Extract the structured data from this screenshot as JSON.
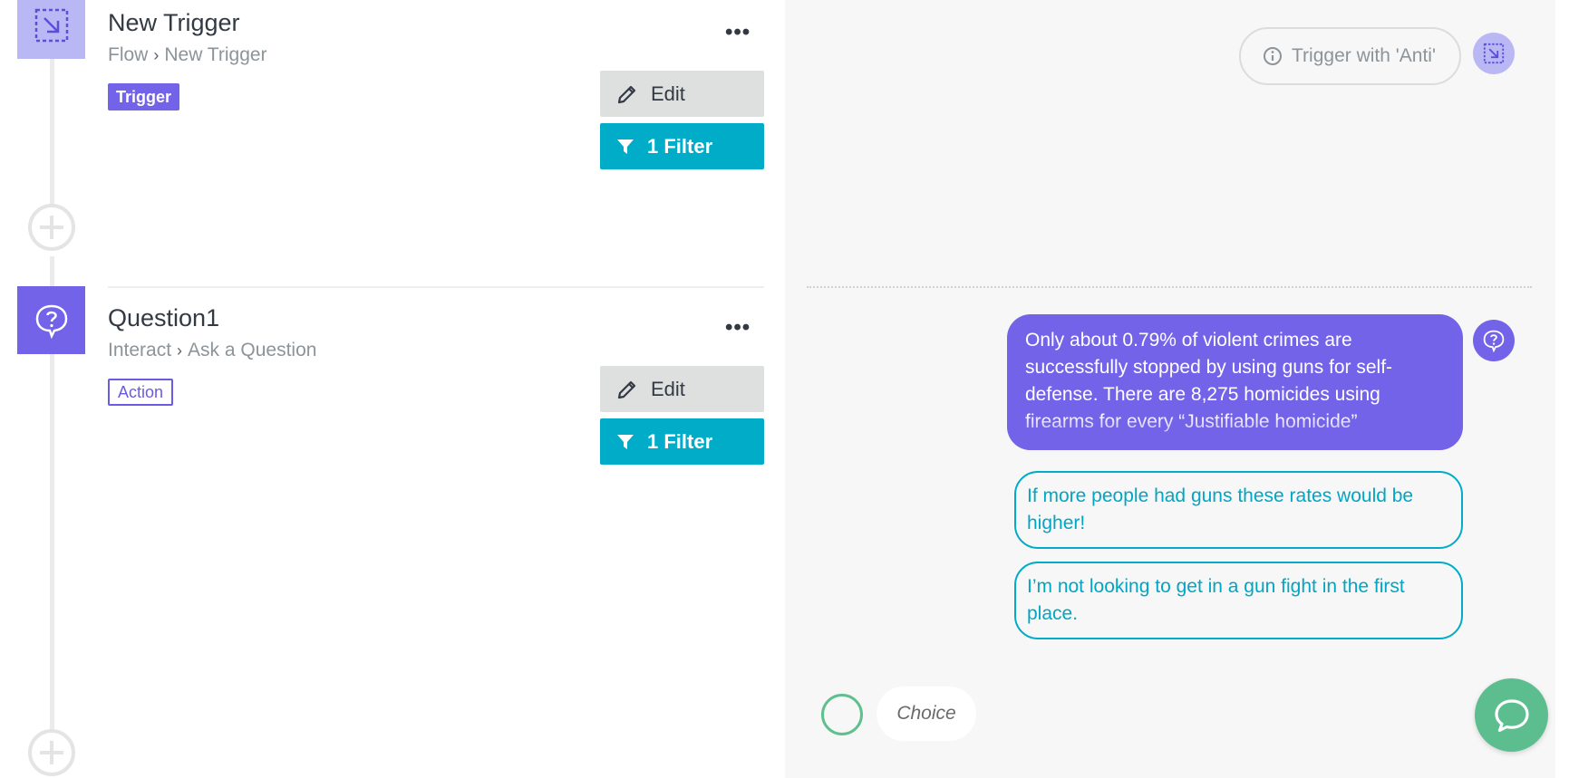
{
  "flow": {
    "steps": [
      {
        "title": "New Trigger",
        "breadcrumb": [
          "Flow",
          "New Trigger"
        ],
        "tag": "Trigger",
        "edit_label": "Edit",
        "filter_label": "1 Filter",
        "icon": "trigger-icon"
      },
      {
        "title": "Question1",
        "breadcrumb": [
          "Interact",
          "Ask a Question"
        ],
        "tag": "Action",
        "edit_label": "Edit",
        "filter_label": "1 Filter",
        "icon": "question-icon"
      }
    ],
    "more_label": "•••"
  },
  "preview": {
    "trigger_pill": "Trigger with 'Anti'",
    "bot_message": "Only about 0.79% of violent crimes are successfully stopped by using guns for self-defense. There are 8,275 homicides using firearms for every “Justifiable homicide”",
    "choices": [
      "If more people had guns these rates would be higher!",
      "I’m not looking to get in a gun fight in the first place."
    ],
    "choice_input_placeholder": "Choice"
  },
  "colors": {
    "accent_purple": "#7363e8",
    "light_purple": "#b9b8f5",
    "filter_teal": "#00acc8",
    "chat_green": "#5cbd8f"
  }
}
